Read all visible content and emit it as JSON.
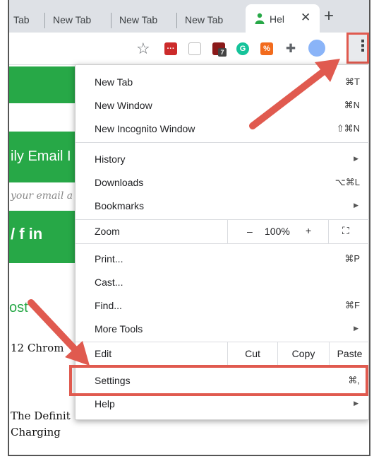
{
  "tabs": [
    {
      "label": "Tab"
    },
    {
      "label": "New Tab"
    },
    {
      "label": "New Tab"
    },
    {
      "label": "New Tab"
    }
  ],
  "active_tab": {
    "label": "Hel",
    "favicon": "person-icon",
    "close": "✕"
  },
  "new_tab_button": "+",
  "toolbar": {
    "bookmark_icon": "star-icon",
    "extensions": [
      "lastpass-icon",
      "pocket-icon",
      "ublock-icon",
      "grammarly-icon",
      "smallpdf-icon",
      "puzzle-icon",
      "profile-icon"
    ],
    "ublock_badge": "7",
    "grammarly_letter": "G",
    "menu_button": "⋮"
  },
  "page": {
    "email_title": "ily Email I",
    "email_placeholder": "your email a",
    "social": "/ f in",
    "posts_heading": "ost",
    "post1": "12 Chrom",
    "post2_line1": "The Definit",
    "post2_line2": "Charging"
  },
  "menu": {
    "new_tab": {
      "label": "New Tab",
      "shortcut": "⌘T"
    },
    "new_window": {
      "label": "New Window",
      "shortcut": "⌘N"
    },
    "incognito": {
      "label": "New Incognito Window",
      "shortcut": "⇧⌘N"
    },
    "history": {
      "label": "History"
    },
    "downloads": {
      "label": "Downloads",
      "shortcut": "⌥⌘L"
    },
    "bookmarks": {
      "label": "Bookmarks"
    },
    "zoom": {
      "label": "Zoom",
      "minus": "–",
      "value": "100%",
      "plus": "+",
      "fullscreen": "⛶"
    },
    "print": {
      "label": "Print...",
      "shortcut": "⌘P"
    },
    "cast": {
      "label": "Cast..."
    },
    "find": {
      "label": "Find...",
      "shortcut": "⌘F"
    },
    "more_tools": {
      "label": "More Tools"
    },
    "edit": {
      "label": "Edit",
      "cut": "Cut",
      "copy": "Copy",
      "paste": "Paste"
    },
    "settings": {
      "label": "Settings",
      "shortcut": "⌘,"
    },
    "help": {
      "label": "Help"
    }
  },
  "colors": {
    "accent_green": "#27a847",
    "highlight_red": "#e05a4f"
  }
}
